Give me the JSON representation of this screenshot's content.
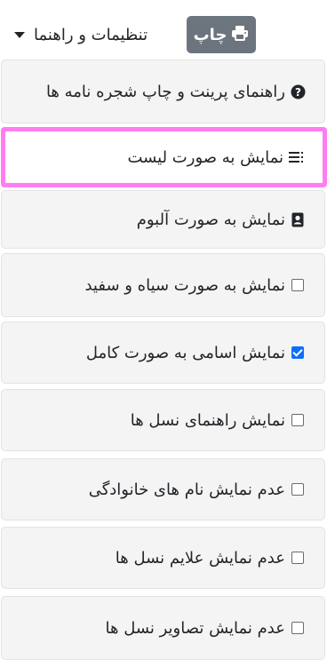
{
  "toolbar": {
    "print_label": "چاپ",
    "print_icon": "printer-icon",
    "settings_label": "تنظیمات و راهنما",
    "settings_icon": "caret-down-icon"
  },
  "menu": {
    "items": [
      {
        "label": "راهنمای پرینت و چاپ شجره نامه ها",
        "icon": "question-circle-icon"
      },
      {
        "label": "نمایش به صورت لیست",
        "icon": "list-icon",
        "active": true
      },
      {
        "label": "نمایش به صورت آلبوم",
        "icon": "portrait-card-icon"
      },
      {
        "label": "نمایش به صورت سیاه و سفید",
        "icon": "checkbox-icon",
        "checked": false
      },
      {
        "label": "نمایش اسامی به صورت کامل",
        "icon": "checkbox-icon",
        "checked": true
      },
      {
        "label": "نمایش راهنمای نسل ها",
        "icon": "checkbox-icon",
        "checked": false
      },
      {
        "label": "عدم نمایش نام های خانوادگی",
        "icon": "checkbox-icon",
        "checked": false
      },
      {
        "label": "عدم نمایش علایم نسل ها",
        "icon": "checkbox-icon",
        "checked": false
      },
      {
        "label": "عدم نمایش تصاویر نسل ها",
        "icon": "checkbox-icon",
        "checked": false
      }
    ]
  },
  "colors": {
    "print_button_bg": "#6c757d",
    "active_highlight": "#ff7df0",
    "checkbox_checked": "#0d6efd",
    "item_bg": "#f4f4f4"
  }
}
